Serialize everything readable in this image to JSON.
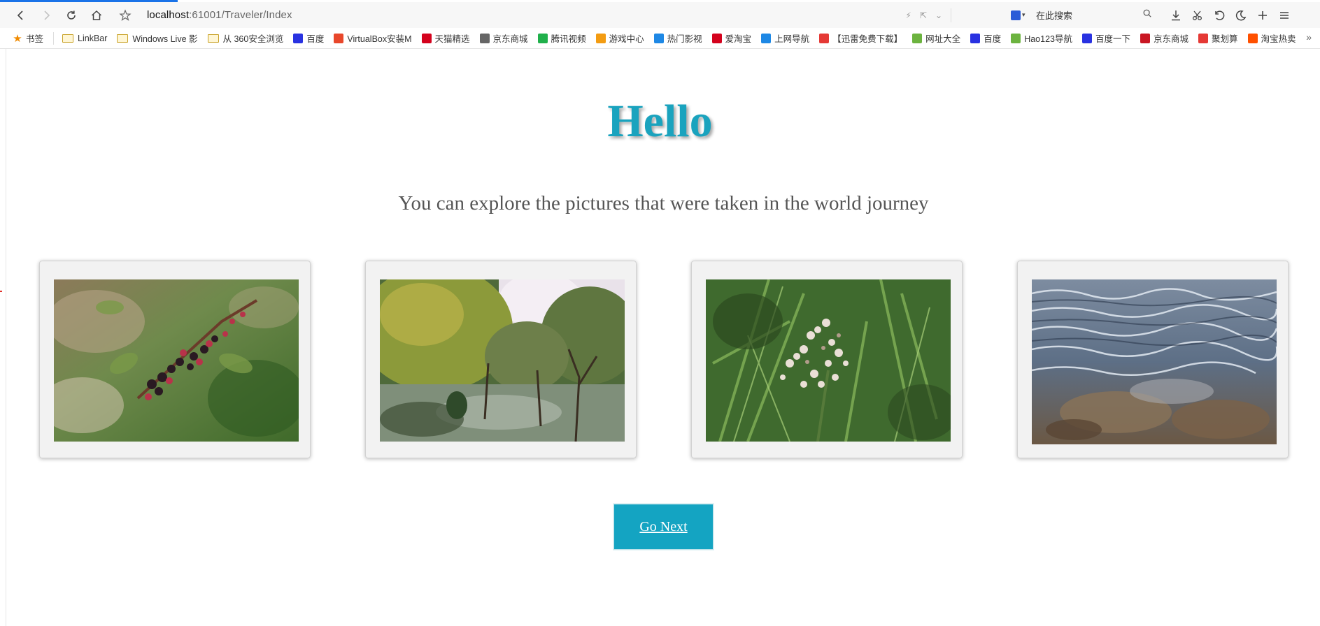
{
  "browser": {
    "url_host": "localhost",
    "url_rest": ":61001/Traveler/Index",
    "search_placeholder": "在此搜索"
  },
  "bookmarks": [
    {
      "label": "书签",
      "icon": "star-icon",
      "color": "#f08a00"
    },
    {
      "label": "LinkBar",
      "icon": "folder-icon",
      "color": "#c9a227"
    },
    {
      "label": "Windows Live 影",
      "icon": "folder-icon",
      "color": "#c9a227"
    },
    {
      "label": "从 360安全浏览",
      "icon": "folder-icon",
      "color": "#c9a227"
    },
    {
      "label": "百度",
      "icon": "baidu-paw-icon",
      "color": "#2932e1"
    },
    {
      "label": "VirtualBox安装M",
      "icon": "c-logo-icon",
      "color": "#e8472b"
    },
    {
      "label": "天猫精选",
      "icon": "tmall-icon",
      "color": "#d4021d"
    },
    {
      "label": "京东商城",
      "icon": "globe-icon",
      "color": "#666666"
    },
    {
      "label": "腾讯视频",
      "icon": "tencent-video-icon",
      "color": "#20b04b"
    },
    {
      "label": "游戏中心",
      "icon": "game-icon",
      "color": "#f39c12"
    },
    {
      "label": "热门影视",
      "icon": "video-icon",
      "color": "#1e88e5"
    },
    {
      "label": "爱淘宝",
      "icon": "taobao-icon",
      "color": "#d4021d"
    },
    {
      "label": "上网导航",
      "icon": "nav-icon",
      "color": "#1e88e5"
    },
    {
      "label": "【迅雷免费下载】",
      "icon": "xunlei-icon",
      "color": "#e53935"
    },
    {
      "label": "网址大全",
      "icon": "hao-icon",
      "color": "#6cb33f"
    },
    {
      "label": "百度",
      "icon": "baidu-paw-icon",
      "color": "#2932e1"
    },
    {
      "label": "Hao123导航",
      "icon": "hao123-icon",
      "color": "#6cb33f"
    },
    {
      "label": "百度一下",
      "icon": "baidu-paw-icon",
      "color": "#2932e1"
    },
    {
      "label": "京东商城",
      "icon": "jd-icon",
      "color": "#c91623"
    },
    {
      "label": "聚划算",
      "icon": "juhuasuan-icon",
      "color": "#e53935"
    },
    {
      "label": "淘宝热卖",
      "icon": "taobao-hot-icon",
      "color": "#ff5000"
    }
  ],
  "page": {
    "title": "Hello",
    "subtitle": "You can explore the pictures that were taken in the world journey",
    "photos": [
      {
        "subject": "blackberries"
      },
      {
        "subject": "garden trees"
      },
      {
        "subject": "white wildflowers"
      },
      {
        "subject": "water surface"
      }
    ],
    "button_label": "Go Next"
  },
  "colors": {
    "accent": "#1aa3be",
    "button": "#14a4c2",
    "card_bg": "#f2f2f2",
    "load_bar": "#1a73e8"
  }
}
